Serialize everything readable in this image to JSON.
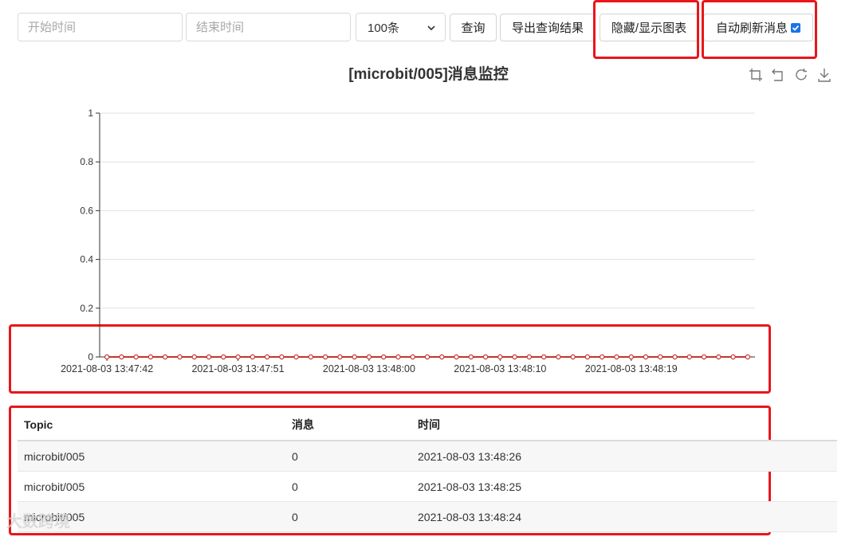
{
  "toolbar": {
    "start_placeholder": "开始时间",
    "end_placeholder": "结束时间",
    "limit_value": "100条",
    "query_label": "查询",
    "export_label": "导出查询结果",
    "toggle_chart_label": "隐藏/显示图表",
    "auto_refresh_label": "自动刷新消息",
    "auto_refresh_checked": true
  },
  "chart": {
    "title": "[microbit/005]消息监控",
    "tools": [
      "crop-icon",
      "undo-icon",
      "refresh-icon",
      "download-icon"
    ]
  },
  "chart_data": {
    "type": "line",
    "title": "[microbit/005]消息监控",
    "xlabel": "",
    "ylabel": "",
    "ylim": [
      0,
      1
    ],
    "y_ticks": [
      "1",
      "0.8",
      "0.6",
      "0.4",
      "0.2",
      "0"
    ],
    "x_tick_labels": [
      "2021-08-03 13:47:42",
      "2021-08-03 13:47:51",
      "2021-08-03 13:48:00",
      "2021-08-03 13:48:10",
      "2021-08-03 13:48:19"
    ],
    "grid": true,
    "series": [
      {
        "color": "#c23531",
        "values": [
          0,
          0,
          0,
          0,
          0,
          0,
          0,
          0,
          0,
          0,
          0,
          0,
          0,
          0,
          0,
          0,
          0,
          0,
          0,
          0,
          0,
          0,
          0,
          0,
          0,
          0,
          0,
          0,
          0,
          0,
          0,
          0,
          0,
          0,
          0,
          0,
          0,
          0,
          0,
          0,
          0,
          0,
          0,
          0,
          0
        ]
      }
    ]
  },
  "table": {
    "headers": [
      "Topic",
      "消息",
      "时间"
    ],
    "rows": [
      [
        "microbit/005",
        "0",
        "2021-08-03 13:48:26"
      ],
      [
        "microbit/005",
        "0",
        "2021-08-03 13:48:25"
      ],
      [
        "microbit/005",
        "0",
        "2021-08-03 13:48:24"
      ]
    ]
  },
  "watermark": "大数跨境",
  "colors": {
    "highlight": "#e8161b",
    "series": "#c23531",
    "accent": "#1a73e8"
  }
}
